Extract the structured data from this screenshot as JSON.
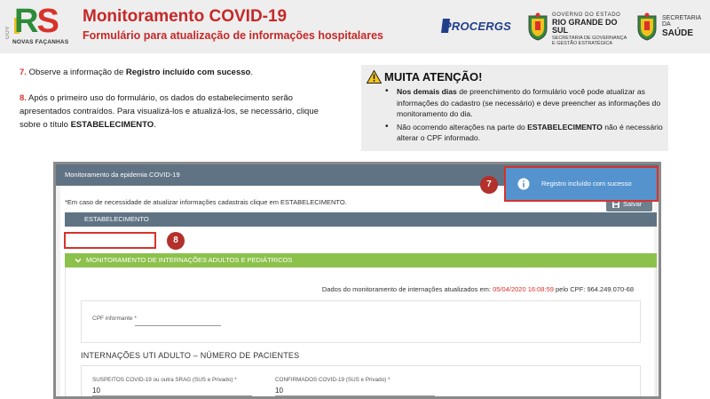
{
  "header": {
    "gov_vertical": "GOV",
    "rs_r": "R",
    "rs_s": "S",
    "rs_subtitle": "NOVAS FAÇANHAS",
    "title": "Monitoramento COVID-19",
    "subtitle": "Formulário para atualização de informações hospitalares",
    "procergs": "PROCERGS",
    "gov_line1": "GOVERNO DO ESTADO",
    "gov_line2": "RIO GRANDE DO SUL",
    "gov_line3": "SECRETARIA DE GOVERNANÇA",
    "gov_line4": "E GESTÃO ESTRATÉGICA",
    "saude_line1": "SECRETARIA DA",
    "saude_line2": "SAÚDE"
  },
  "colors": {
    "accent_red": "#c62828",
    "badge_red": "#b3302b",
    "panel_slate": "#5f7384",
    "green_bar": "#8cc14c",
    "toast_blue": "#5593cf"
  },
  "instructions": {
    "step7": {
      "num": "7.",
      "pre": " Observe a informação de ",
      "bold": "Registro incluído com sucesso",
      "post": "."
    },
    "step8": {
      "num": "8.",
      "text": " Após o primeiro uso do formulário, os dados do estabelecimento serão apresentados contraídos. Para visualizá-los e atualizá-los, se necessário, clique sobre o título ",
      "bold": "ESTABELECIMENTO",
      "post": "."
    }
  },
  "attention": {
    "title": "MUITA ATENÇÃO!",
    "item1_bold": "Nos demais dias",
    "item1_text": " de preenchimento do formulário você pode atualizar as informações do cadastro (se necessário) e deve preencher as informações do monitoramento do dia.",
    "item2_pre": "Não ocorrendo alterações na parte do ",
    "item2_bold": "ESTABELECIMENTO",
    "item2_post": " não é necessário alterar o CPF informado."
  },
  "app": {
    "header_title": "Monitoramento da epidemia COVID-19",
    "toast_text": "Registro incluído com sucesso",
    "badge7": "7",
    "badge8": "8",
    "save_label": "Salvar",
    "note": "*Em caso de necessidade de atualizar informações cadastrais clique em ESTABELECIMENTO.",
    "estab_label": "ESTABELECIMENTO",
    "green_label": "MONITORAMENTO DE INTERNAÇÕES ADULTOS E PEDIÁTRICOS",
    "update_pre": "Dados do monitoramento de internações atualizados em: ",
    "update_date": "05/04/2020 16:08:59",
    "update_mid": " pelo CPF: ",
    "update_cpf": "964.249.070-68",
    "cpf_label": "CPF informante *",
    "section_title": "INTERNAÇÕES UTI ADULTO – NÚMERO DE PACIENTES",
    "field1_label": "SUSPEITOS COVID-19 ou outra SRAG (SUS e Privado) *",
    "field1_value": "10",
    "field2_label": "CONFIRMADOS COVID-19 (SUS e Privado) *",
    "field2_value": "10"
  }
}
